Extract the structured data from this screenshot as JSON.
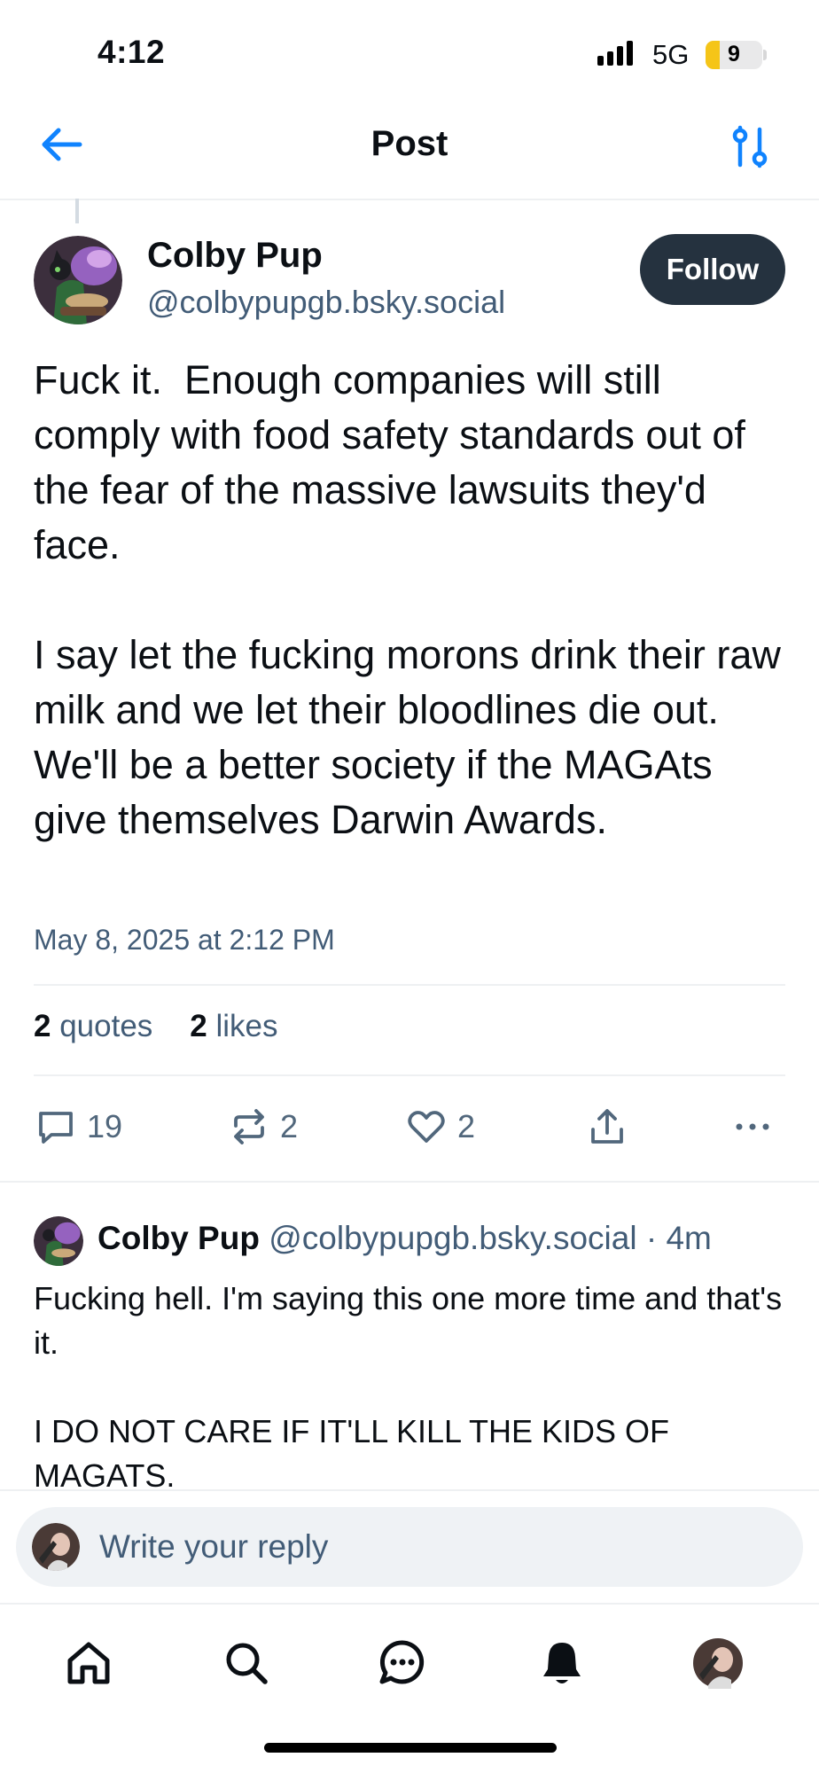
{
  "status_bar": {
    "time": "4:12",
    "network": "5G",
    "battery": "9",
    "battery_level_percent": 9
  },
  "header": {
    "title": "Post",
    "back_icon": "arrow-left-icon",
    "filter_icon": "sliders-icon"
  },
  "post": {
    "author_name": "Colby Pup",
    "author_handle": "@colbypupgb.bsky.social",
    "follow_label": "Follow",
    "text": "Fuck it.  Enough companies will still comply with food safety standards out of the fear of the massive lawsuits they'd face.\n\nI say let the fucking morons drink their raw milk and we let their bloodlines die out.  We'll be a better society if the MAGAts give themselves Darwin Awards.",
    "date": "May 8, 2025 at 2:12 PM",
    "stats": {
      "quotes_count": "2",
      "quotes_label": "quotes",
      "likes_count": "2",
      "likes_label": "likes"
    },
    "actions": {
      "replies": "19",
      "reposts": "2",
      "likes": "2"
    }
  },
  "reply": {
    "author_name": "Colby Pup",
    "author_handle": "@colbypupgb.bsky.social",
    "separator": " · ",
    "age": "4m",
    "text": "Fucking hell. I'm saying this one more time and that's it.\n\nI DO NOT CARE IF IT'LL KILL THE KIDS OF MAGATS."
  },
  "composer": {
    "placeholder": "Write your reply"
  },
  "tab_bar": {
    "items": [
      "home-icon",
      "search-icon",
      "chat-icon",
      "bell-icon",
      "profile-avatar"
    ]
  },
  "colors": {
    "text_primary": "#0b0f14",
    "text_secondary": "#425c77",
    "icon_secondary": "#51677c",
    "accent": "#1083fe",
    "follow_button_bg": "#25323f",
    "divider": "#eef0f2",
    "composer_bg": "#eff2f5"
  }
}
